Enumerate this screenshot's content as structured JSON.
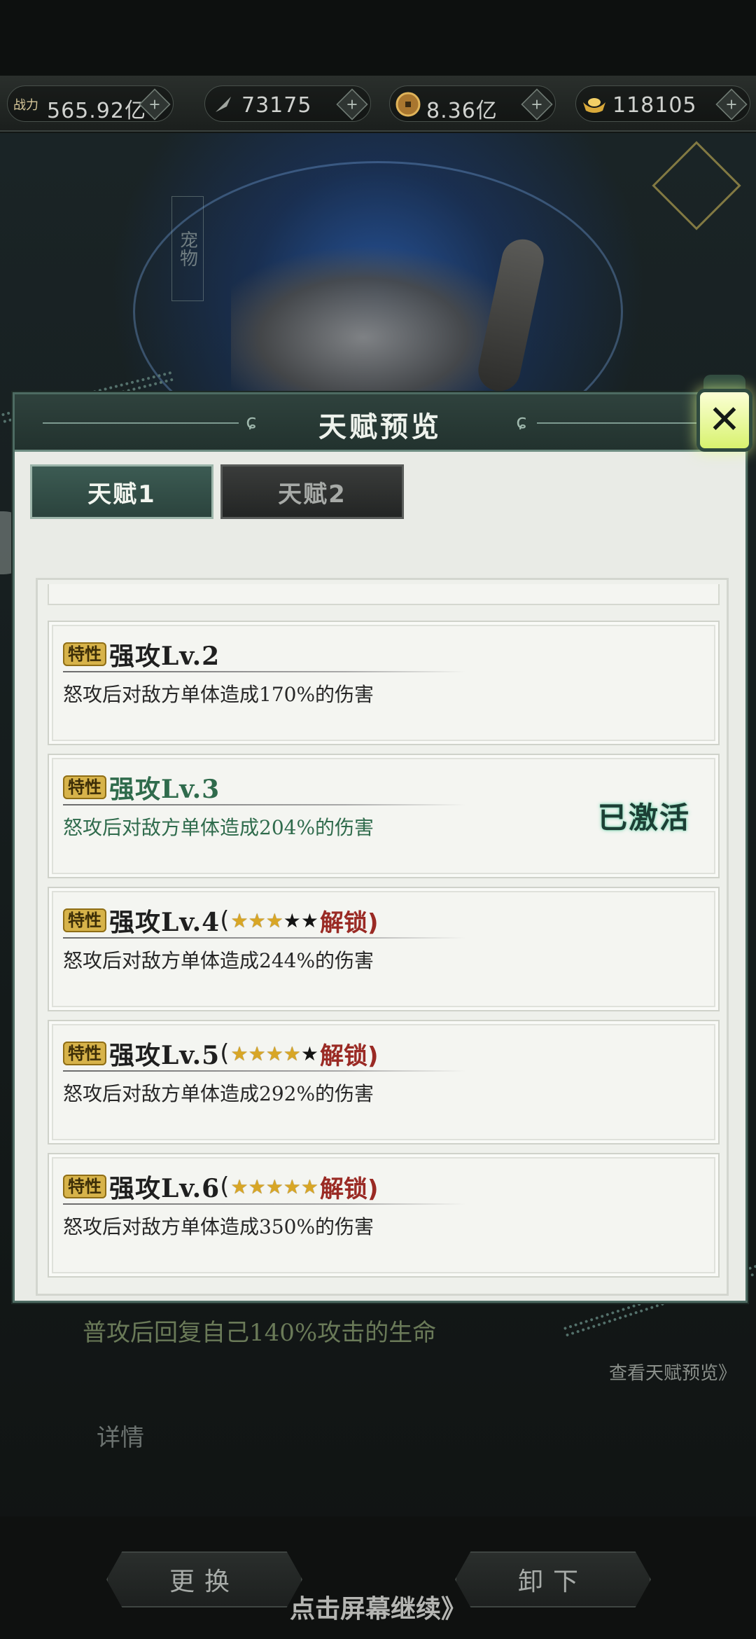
{
  "resources": [
    {
      "icon": "battle-power-icon",
      "label": "战力",
      "value": "565.92亿"
    },
    {
      "icon": "feather-icon",
      "label": "",
      "value": "73175"
    },
    {
      "icon": "coin-icon",
      "label": "",
      "value": "8.36亿"
    },
    {
      "icon": "ingot-icon",
      "label": "",
      "value": "118105"
    }
  ],
  "background": {
    "vertical_tag": "宠物",
    "passive_text": "普攻后回复自己140%攻击的生命",
    "view_talent_link": "查看天赋预览》",
    "detail_label": "详情",
    "replace_button": "更换",
    "unequip_button": "卸下",
    "continue_hint": "点击屏幕继续》"
  },
  "modal": {
    "title": "天赋预览",
    "close_symbol": "✕",
    "tabs": [
      {
        "label": "天赋1",
        "active": true
      },
      {
        "label": "天赋2",
        "active": false
      }
    ],
    "trait_badge": "特性",
    "unlock_open": "(",
    "unlock_close": "解锁)",
    "active_status": "已激活",
    "talents": [
      {
        "name": "强攻Lv.2",
        "description": "怒攻后对敌方单体造成170%的伤害",
        "active": false,
        "stars_gold": 0,
        "stars_total": 0
      },
      {
        "name": "强攻Lv.3",
        "description": "怒攻后对敌方单体造成204%的伤害",
        "active": true,
        "stars_gold": 0,
        "stars_total": 0
      },
      {
        "name": "强攻Lv.4",
        "description": "怒攻后对敌方单体造成244%的伤害",
        "active": false,
        "stars_gold": 3,
        "stars_total": 5
      },
      {
        "name": "强攻Lv.5",
        "description": "怒攻后对敌方单体造成292%的伤害",
        "active": false,
        "stars_gold": 4,
        "stars_total": 5
      },
      {
        "name": "强攻Lv.6",
        "description": "怒攻后对敌方单体造成350%的伤害",
        "active": false,
        "stars_gold": 5,
        "stars_total": 5
      }
    ]
  }
}
